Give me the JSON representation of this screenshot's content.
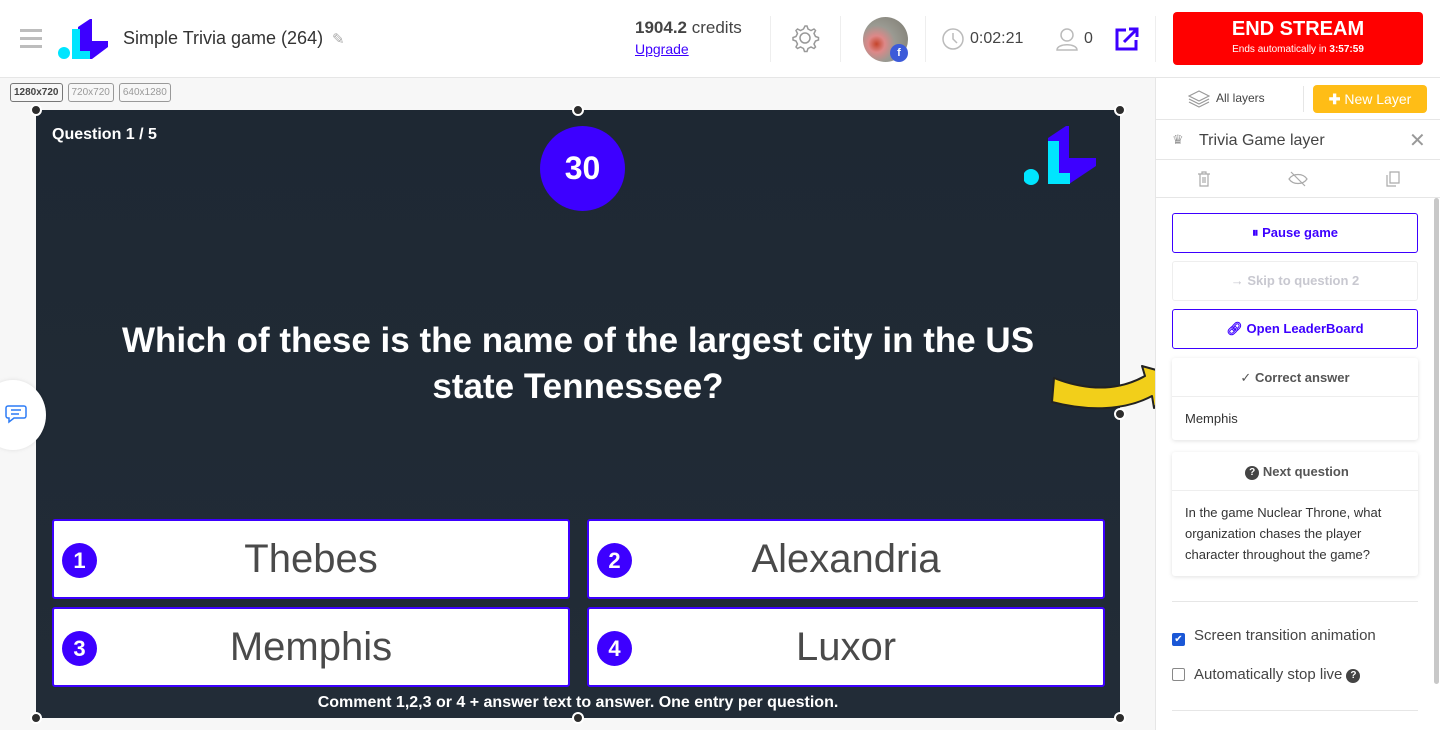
{
  "header": {
    "title": "Simple Trivia game (264)",
    "credits_value": "1904.2",
    "credits_label": "credits",
    "upgrade_label": "Upgrade",
    "elapsed": "0:02:21",
    "viewers": "0",
    "avatar_badge": "f",
    "end_stream_label": "END STREAM",
    "end_auto_prefix": "Ends automatically in",
    "end_auto_time": "3:57:59"
  },
  "sizes": [
    "1280x720",
    "720x720",
    "640x1280"
  ],
  "game": {
    "question_counter": "Question 1 / 5",
    "timer": "30",
    "question": "Which of these is the name of the largest city in the US state Tennessee?",
    "answers": [
      {
        "num": "1",
        "text": "Thebes"
      },
      {
        "num": "2",
        "text": "Alexandria"
      },
      {
        "num": "3",
        "text": "Memphis"
      },
      {
        "num": "4",
        "text": "Luxor"
      }
    ],
    "hint": "Comment 1,2,3 or 4 + answer text to answer. One entry per question."
  },
  "panel": {
    "all_layers": "All layers",
    "new_layer": "New Layer",
    "layer_name": "Trivia Game layer",
    "pause": "Pause game",
    "skip": "Skip to question 2",
    "leaderboard": "Open LeaderBoard",
    "correct_title": "Correct answer",
    "correct_value": "Memphis",
    "next_title": "Next question",
    "next_value": "In the game Nuclear Throne, what organization chases the player character throughout the game?",
    "opt_transition": "Screen transition animation",
    "opt_transition_checked": true,
    "opt_autostop": "Automatically stop live",
    "opt_autostop_checked": false
  },
  "colors": {
    "accent": "#3d00ff",
    "end_stream": "#ff0000",
    "new_layer": "#ffbd16",
    "logo_cyan": "#00e5ff"
  }
}
